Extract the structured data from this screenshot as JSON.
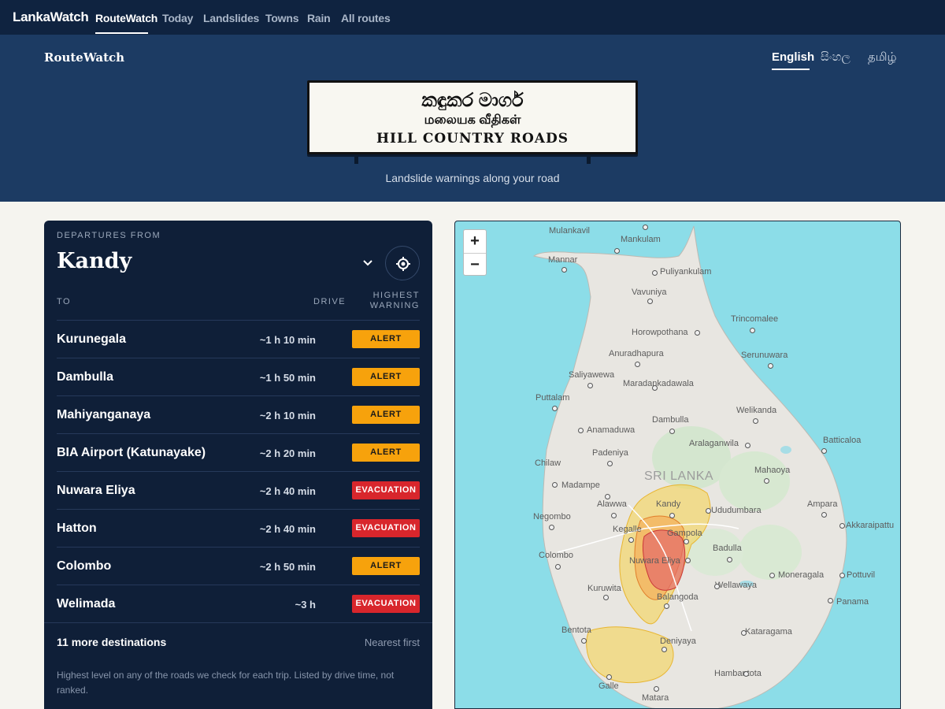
{
  "nav": {
    "brand": "LankaWatch",
    "items": [
      "RouteWatch",
      "Today",
      "Landslides",
      "Towns",
      "Rain",
      "All routes"
    ],
    "active": "RouteWatch"
  },
  "hero": {
    "title": "RouteWatch",
    "languages": [
      "English",
      "සිංහල",
      "தமிழ்"
    ],
    "active_language": "English",
    "sign": {
      "sinhala": "කඳුකර මාර්ග",
      "tamil": "மலையக வீதிகள்",
      "english": "HILL COUNTRY ROADS"
    },
    "tagline": "Landslide warnings along your road"
  },
  "departures": {
    "label": "DEPARTURES FROM",
    "city": "Kandy",
    "columns": {
      "to": "TO",
      "drive": "DRIVE",
      "warning": "HIGHEST WARNING"
    },
    "rows": [
      {
        "dest": "Kurunegala",
        "drive": "~1 h 10 min",
        "level": "ALERT"
      },
      {
        "dest": "Dambulla",
        "drive": "~1 h 50 min",
        "level": "ALERT"
      },
      {
        "dest": "Mahiyanganaya",
        "drive": "~2 h 10 min",
        "level": "ALERT"
      },
      {
        "dest": "BIA Airport (Katunayake)",
        "drive": "~2 h 20 min",
        "level": "ALERT"
      },
      {
        "dest": "Nuwara Eliya",
        "drive": "~2 h 40 min",
        "level": "EVACUATION"
      },
      {
        "dest": "Hatton",
        "drive": "~2 h 40 min",
        "level": "EVACUATION"
      },
      {
        "dest": "Colombo",
        "drive": "~2 h 50 min",
        "level": "ALERT"
      },
      {
        "dest": "Welimada",
        "drive": "~3 h",
        "level": "EVACUATION"
      }
    ],
    "more": "11 more destinations",
    "sort": "Nearest first",
    "note": "Highest level on any of the roads we check for each trip. Listed by drive time, not ranked."
  },
  "colors": {
    "alert": "#f7a20c",
    "evacuation": "#d8262c",
    "navy": "#0f1f38",
    "hero": "#1c3b63"
  },
  "map": {
    "zoom_in": "+",
    "zoom_out": "−",
    "country": "SRI LANKA",
    "places": [
      "Mulankavil",
      "Mankulam",
      "Mannar",
      "Puliyankulam",
      "Vavuniya",
      "Horowpothana",
      "Trincomalee",
      "Anuradhapura",
      "Serunuwara",
      "Saliyawewa",
      "Maradankadawala",
      "Puttalam",
      "Welikanda",
      "Dambulla",
      "Anamaduwa",
      "Batticaloa",
      "Aralaganwila",
      "Padeniya",
      "Chilaw",
      "Mahaoya",
      "Madampe",
      "Alawwa",
      "Kandy",
      "Ampara",
      "Negombo",
      "Ududumbara",
      "Akkaraipattu",
      "Kegalle",
      "Gampola",
      "Badulla",
      "Colombo",
      "Nuwara Eliya",
      "Moneragala",
      "Pottuvil",
      "Kuruwita",
      "Wellawaya",
      "Balangoda",
      "Panama",
      "Bentota",
      "Deniyaya",
      "Kataragama",
      "Hambantota",
      "Galle",
      "Matara"
    ]
  }
}
